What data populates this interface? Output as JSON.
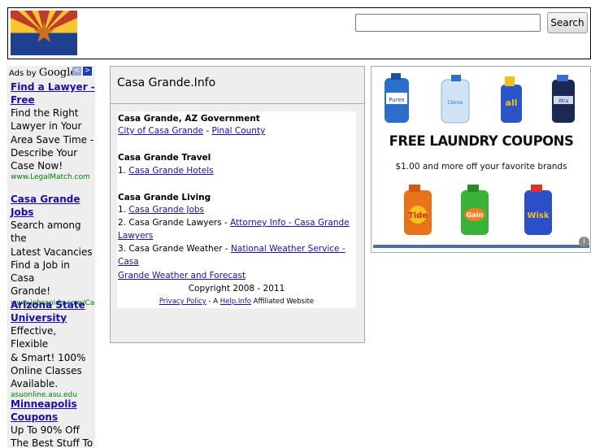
{
  "header": {
    "search_placeholder": "",
    "search_button": "Search"
  },
  "ads_sidebar": {
    "ads_by": "Ads by ",
    "google": "Google",
    "prev_arrow": "<",
    "next_arrow": ">",
    "ads": [
      {
        "title_lines": [
          "Find a Lawyer -",
          "Free"
        ],
        "desc_lines": [
          "Find the Right",
          "Lawyer in Your",
          "Area Save Time -",
          "Describe Your",
          "Case Now!"
        ],
        "url": "www.LegalMatch.com"
      },
      {
        "title_lines": [
          "Casa Grande",
          "Jobs"
        ],
        "desc_lines": [
          "Search among the",
          "Latest Vacancies",
          "Find a Job in Casa",
          "Grande!"
        ],
        "url": "www.jobrapido.com/Cas"
      },
      {
        "title_lines": [
          "Arizona State",
          "University"
        ],
        "desc_lines": [
          "Effective, Flexible",
          "& Smart! 100%",
          "Online Classes",
          "Available."
        ],
        "url": "asuonline.asu.edu"
      },
      {
        "title_lines": [
          "Minneapolis",
          "Coupons"
        ],
        "desc_lines": [
          "Up To 90% Off",
          "The Best Stuff To"
        ],
        "url": ""
      }
    ]
  },
  "main": {
    "title": "Casa Grande.Info",
    "sections": {
      "government": {
        "heading": "Casa Grande, AZ Government",
        "link1": "City of Casa Grande",
        "sep": " - ",
        "link2": "Pinal County"
      },
      "travel": {
        "heading": "Casa Grande Travel",
        "num": "1. ",
        "link": "Casa Grande Hotels"
      },
      "living": {
        "heading": "Casa Grande Living",
        "item1_num": "1. ",
        "item1_link": "Casa Grande Jobs",
        "item2_text": "2. Casa Grande Lawyers - ",
        "item2_link_a": "Attorney Info - Casa Grande",
        "item2_link_b": "Lawyers",
        "item3_text": "3. Casa Grande Weather - ",
        "item3_link_a": "National Weather Service - Casa",
        "item3_link_b": "Grande Weather and Forecast"
      }
    },
    "copyright": "Copyright 2008 - 2011",
    "footer": {
      "privacy": "Privacy Policy",
      "mid": " - A ",
      "help": "Help.Info",
      "tail": " Affiliated Website"
    }
  },
  "banner_ad": {
    "headline": "FREE LAUNDRY COUPONS",
    "subline": "$1.00 and more off your favorite brands",
    "brands_top": [
      "Purex",
      "Clorox",
      "all",
      "Xtra"
    ],
    "brands_bottom": [
      "Tide",
      "Gain",
      "Wisk"
    ],
    "info_icon": "i"
  },
  "colors": {
    "flag_red": "#bf3a2b",
    "flag_yellow": "#f7c531",
    "flag_blue": "#1f3f8f",
    "flag_copper": "#c7721c",
    "link": "#1a0dab",
    "ad_url": "#008000",
    "panel_bg": "#eeeeee"
  }
}
